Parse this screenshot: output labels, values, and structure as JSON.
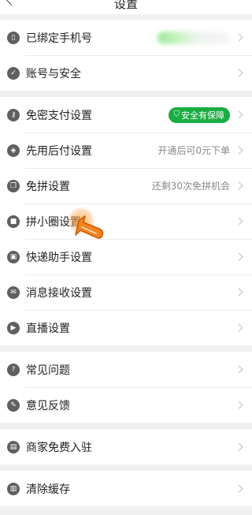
{
  "header": {
    "title": "设置"
  },
  "groups": [
    {
      "items": [
        {
          "label": "已绑定手机号",
          "icon": "phone-icon"
        },
        {
          "label": "账号与安全",
          "icon": "shield-icon"
        }
      ]
    },
    {
      "items": [
        {
          "label": "免密支付设置",
          "icon": "key-icon",
          "badge": "安全有保障"
        },
        {
          "label": "先用后付设置",
          "icon": "pay-later-icon",
          "value": "开通后可0元下单"
        },
        {
          "label": "免拼设置",
          "icon": "copy-icon",
          "value": "还剩30次免拼机会"
        },
        {
          "label": "拼小圈设置",
          "icon": "lock-icon"
        },
        {
          "label": "快递助手设置",
          "icon": "package-icon"
        },
        {
          "label": "消息接收设置",
          "icon": "mail-icon"
        },
        {
          "label": "直播设置",
          "icon": "video-icon"
        }
      ]
    },
    {
      "items": [
        {
          "label": "常见问题",
          "icon": "question-icon"
        },
        {
          "label": "意见反馈",
          "icon": "edit-icon"
        }
      ]
    },
    {
      "items": [
        {
          "label": "商家免费入驻",
          "icon": "store-icon"
        }
      ]
    },
    {
      "items": [
        {
          "label": "清除缓存",
          "icon": "trash-icon"
        }
      ]
    }
  ],
  "colors": {
    "accent_green": "#1aad42",
    "pointer_orange": "#f58220"
  }
}
